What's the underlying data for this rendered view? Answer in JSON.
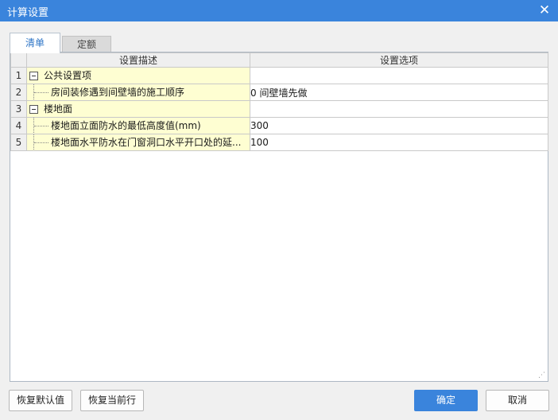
{
  "window": {
    "title": "计算设置",
    "close_glyph": "✕"
  },
  "tabs": [
    {
      "label": "清单",
      "active": true
    },
    {
      "label": "定额",
      "active": false
    }
  ],
  "grid": {
    "columns": [
      "设置描述",
      "设置选项"
    ],
    "rows": [
      {
        "num": "1",
        "type": "group",
        "desc": "公共设置项",
        "value": ""
      },
      {
        "num": "2",
        "type": "child",
        "desc": "房间装修遇到间壁墙的施工顺序",
        "value": "0 间壁墙先做"
      },
      {
        "num": "3",
        "type": "group",
        "desc": "楼地面",
        "value": ""
      },
      {
        "num": "4",
        "type": "child",
        "desc": "楼地面立面防水的最低高度值(mm)",
        "value": "300"
      },
      {
        "num": "5",
        "type": "child",
        "desc": "楼地面水平防水在门窗洞口水平开口处的延...",
        "value": "100"
      }
    ]
  },
  "buttons": {
    "restore_default": "恢复默认值",
    "restore_row": "恢复当前行",
    "ok": "确定",
    "cancel": "取消"
  },
  "colors": {
    "accent": "#3a84dc",
    "desc_cell_bg": "#fefed2"
  }
}
